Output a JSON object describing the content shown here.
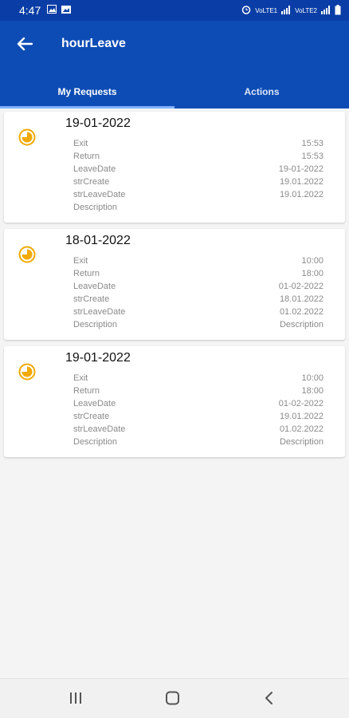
{
  "status_bar": {
    "time": "4:47",
    "right_labels": [
      "VoLTE1",
      "VoLTE2"
    ]
  },
  "app_bar": {
    "title": "hourLeave",
    "tabs": [
      {
        "label": "My Requests",
        "active": true
      },
      {
        "label": "Actions",
        "active": false
      }
    ]
  },
  "colors": {
    "app_bar": "#0d4cb5",
    "status_bar": "#0a3ea6",
    "icon": "#f2a900"
  },
  "requests": [
    {
      "date": "19-01-2022",
      "icon": "clock-half-icon",
      "fields": [
        {
          "label": "Exit",
          "value": "15:53"
        },
        {
          "label": "Return",
          "value": "15:53"
        },
        {
          "label": "LeaveDate",
          "value": "19-01-2022"
        },
        {
          "label": "strCreate",
          "value": "19.01.2022"
        },
        {
          "label": "strLeaveDate",
          "value": "19.01.2022"
        },
        {
          "label": "Description",
          "value": ""
        }
      ]
    },
    {
      "date": "18-01-2022",
      "icon": "clock-half-icon",
      "fields": [
        {
          "label": "Exit",
          "value": "10:00"
        },
        {
          "label": "Return",
          "value": "18:00"
        },
        {
          "label": "LeaveDate",
          "value": "01-02-2022"
        },
        {
          "label": "strCreate",
          "value": "18.01.2022"
        },
        {
          "label": "strLeaveDate",
          "value": "01.02.2022"
        },
        {
          "label": "Description",
          "value": "Description"
        }
      ]
    },
    {
      "date": "19-01-2022",
      "icon": "clock-half-icon",
      "fields": [
        {
          "label": "Exit",
          "value": "10:00"
        },
        {
          "label": "Return",
          "value": "18:00"
        },
        {
          "label": "LeaveDate",
          "value": "01-02-2022"
        },
        {
          "label": "strCreate",
          "value": "19.01.2022"
        },
        {
          "label": "strLeaveDate",
          "value": "01.02.2022"
        },
        {
          "label": "Description",
          "value": "Description"
        }
      ]
    }
  ]
}
